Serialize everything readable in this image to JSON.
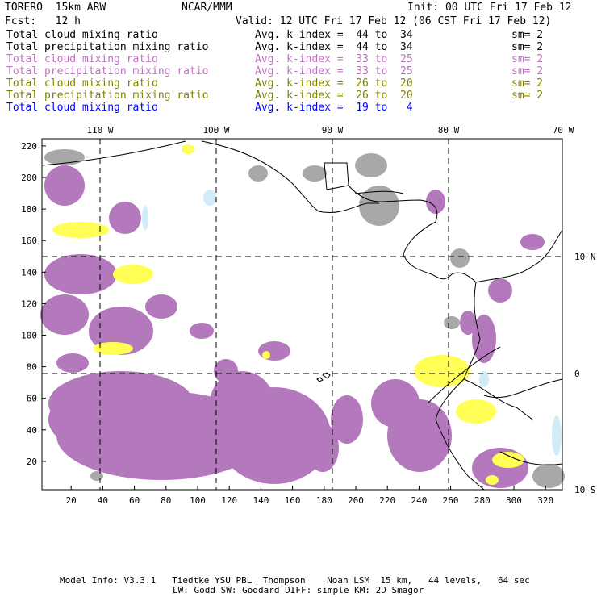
{
  "header": {
    "model": "TORERO  15km ARW",
    "org": "NCAR/MMM",
    "init": "Init: 00 UTC Fri 17 Feb 12",
    "fcst": "Fcst:   12 h",
    "valid": "Valid: 12 UTC Fri 17 Feb 12 (06 CST Fri 17 Feb 12)"
  },
  "legend": [
    {
      "field": "Total cloud mixing ratio",
      "avg": "Avg. k-index =  44 to  34",
      "sm": "sm= 2",
      "color": "#000000"
    },
    {
      "field": "Total precipitation mixing ratio",
      "avg": "Avg. k-index =  44 to  34",
      "sm": "sm= 2",
      "color": "#000000"
    },
    {
      "field": "Total cloud mixing ratio",
      "avg": "Avg. k-index =  33 to  25",
      "sm": "sm= 2",
      "color": "#c070c0"
    },
    {
      "field": "Total precipitation mixing ratio",
      "avg": "Avg. k-index =  33 to  25",
      "sm": "sm= 2",
      "color": "#c070c0"
    },
    {
      "field": "Total cloud mixing ratio",
      "avg": "Avg. k-index =  26 to  20",
      "sm": "sm= 2",
      "color": "#808000"
    },
    {
      "field": "Total precipitation mixing ratio",
      "avg": "Avg. k-index =  26 to  20",
      "sm": "sm= 2",
      "color": "#808000"
    },
    {
      "field": "Total cloud mixing ratio",
      "avg": "Avg. k-index =  19 to   4",
      "sm": "",
      "color": "#0000ff"
    }
  ],
  "map": {
    "lon_labels": [
      "110 W",
      "100 W",
      "90 W",
      "80 W",
      "70 W"
    ],
    "lat_labels": [
      "10 N",
      "0",
      "10 S"
    ],
    "x_ticks": [
      "20",
      "40",
      "60",
      "80",
      "100",
      "120",
      "140",
      "160",
      "180",
      "200",
      "220",
      "240",
      "260",
      "280",
      "300",
      "320"
    ],
    "y_ticks": [
      "20",
      "40",
      "60",
      "80",
      "100",
      "120",
      "140",
      "160",
      "180",
      "200",
      "220"
    ],
    "fill_colors": {
      "purple": "#b478bc",
      "yellow": "#ffff55",
      "gray": "#a8a8a8",
      "lightblue": "#d0ecf8"
    }
  },
  "footer": {
    "line1": "Model Info: V3.3.1   Tiedtke YSU PBL  Thompson    Noah LSM  15 km,   44 levels,   64 sec",
    "line2": "LW: Godd SW: Goddard DIFF: simple KM: 2D Smagor"
  }
}
